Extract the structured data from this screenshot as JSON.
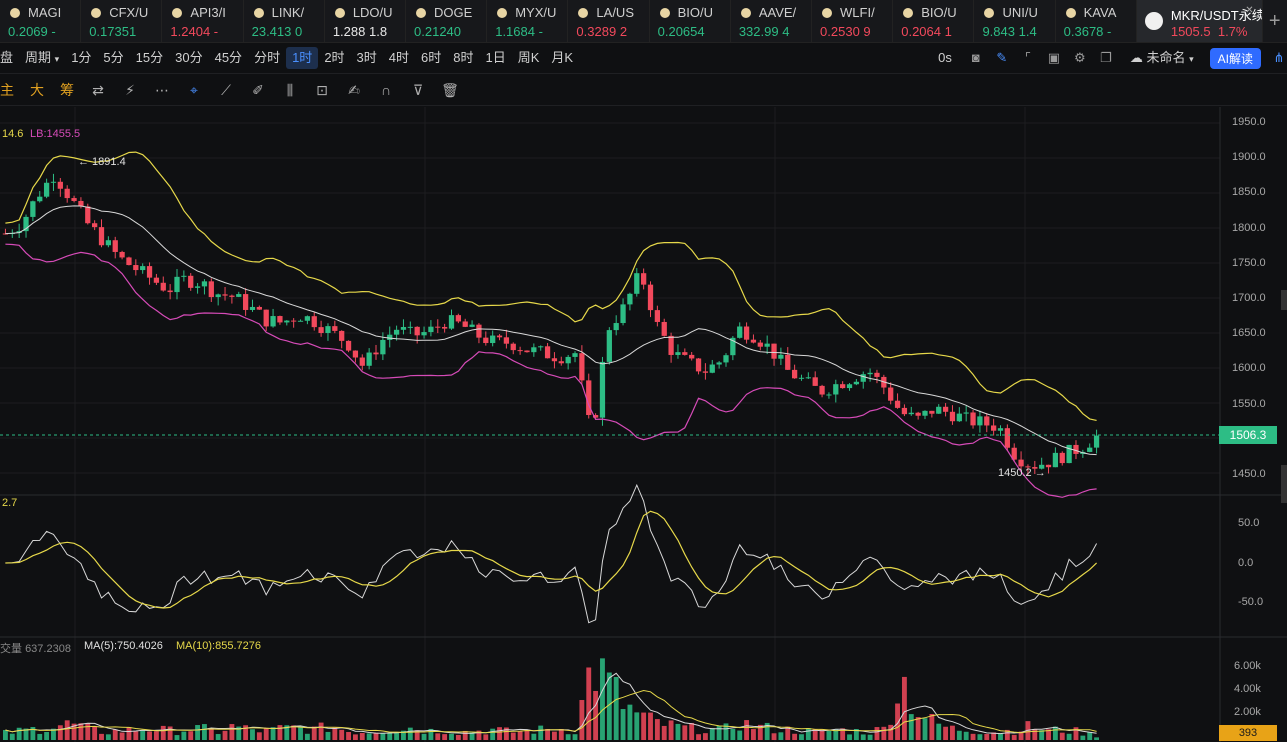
{
  "tabs": [
    {
      "symbol": "MAGI",
      "price": "0.2069",
      "change": "-",
      "dir": "g"
    },
    {
      "symbol": "CFX/U",
      "price": "0.17351",
      "change": "",
      "dir": "g"
    },
    {
      "symbol": "API3/I",
      "price": "1.2404",
      "change": "-",
      "dir": "r"
    },
    {
      "symbol": "LINK/",
      "price": "23.413",
      "change": "0",
      "dir": "g"
    },
    {
      "symbol": "LDO/U",
      "price": "1.288",
      "change": "1.8",
      "dir": "w"
    },
    {
      "symbol": "DOGE",
      "price": "0.21240",
      "change": "",
      "dir": "g"
    },
    {
      "symbol": "MYX/U",
      "price": "1.1684",
      "change": "-",
      "dir": "g"
    },
    {
      "symbol": "LA/US",
      "price": "0.3289",
      "change": "2",
      "dir": "r"
    },
    {
      "symbol": "BIO/U",
      "price": "0.20654",
      "change": "",
      "dir": "g"
    },
    {
      "symbol": "AAVE/",
      "price": "332.99",
      "change": "4",
      "dir": "g"
    },
    {
      "symbol": "WLFI/",
      "price": "0.2530",
      "change": "9",
      "dir": "r"
    },
    {
      "symbol": "BIO/U",
      "price": "0.2064",
      "change": "1",
      "dir": "r"
    },
    {
      "symbol": "UNI/U",
      "price": "9.843",
      "change": "1.4",
      "dir": "g"
    },
    {
      "symbol": "KAVA",
      "price": "0.3678",
      "change": "-",
      "dir": "g"
    }
  ],
  "active_tab": {
    "symbol": "MKR/USDT永续",
    "price": "1505.5",
    "change": "1.7%"
  },
  "toolbar": {
    "left_label": "盘",
    "period_label": "周期",
    "intervals": [
      "1分",
      "5分",
      "15分",
      "30分",
      "45分",
      "分时",
      "1时",
      "2时",
      "3时",
      "4时",
      "6时",
      "8时",
      "1日",
      "周K",
      "月K"
    ],
    "selected_interval": "1时",
    "timer": "0s",
    "layout_name": "未命名",
    "ai_label": "AI解读"
  },
  "toolbar2": {
    "labels": [
      "主",
      "大",
      "筹"
    ]
  },
  "chart_labels": {
    "bb_legend_left": "14.6",
    "bb_legend_lb": "LB:1455.5",
    "high_marker": "← 1891.4",
    "low_marker": "1450.2 →",
    "osc_legend": "2.7",
    "vol_legend_name": "交量",
    "vol_legend_value": "637.2308",
    "ma5": "MA(5):750.4026",
    "ma10": "MA(10):855.7276"
  },
  "price_axis": [
    "1950.0",
    "1900.0",
    "1850.0",
    "1800.0",
    "1750.0",
    "1700.0",
    "1650.0",
    "1600.0",
    "1550.0",
    "1500.0",
    "1450.0"
  ],
  "current_price": "1506.3",
  "osc_axis": [
    "50.0",
    "0.0",
    "-50.0"
  ],
  "vol_axis": [
    "6.00k",
    "4.00k",
    "2.00k"
  ],
  "current_volume": "393",
  "colors": {
    "up": "#2dbd85",
    "down": "#f2495c",
    "upper_band": "#e6d84a",
    "lower_band": "#d64bb8",
    "mid_band": "#d8d8d8",
    "accent": "#2f6bff"
  },
  "chart_data": {
    "type": "candlestick",
    "ylim": [
      1430,
      1975
    ],
    "close_path": [
      1795,
      1810,
      1850,
      1880,
      1845,
      1810,
      1785,
      1760,
      1745,
      1730,
      1715,
      1730,
      1725,
      1710,
      1705,
      1690,
      1672,
      1668,
      1680,
      1670,
      1655,
      1640,
      1605,
      1640,
      1660,
      1650,
      1655,
      1670,
      1665,
      1650,
      1640,
      1640,
      1630,
      1625,
      1620,
      1625,
      1505,
      1660,
      1690,
      1740,
      1665,
      1625,
      1610,
      1600,
      1615,
      1660,
      1650,
      1630,
      1600,
      1585,
      1570,
      1580,
      1590,
      1600,
      1575,
      1540,
      1530,
      1545,
      1540,
      1530,
      1525,
      1520,
      1480,
      1465,
      1470,
      1480,
      1490,
      1506
    ],
    "volume_path": [
      0.6,
      0.8,
      1.0,
      1.2,
      1.4,
      1.0,
      0.7,
      0.8,
      0.9,
      1.0,
      0.8,
      0.9,
      1.0,
      0.7,
      1.2,
      0.9,
      0.8,
      1.0,
      1.1,
      0.9,
      1.2,
      0.8,
      0.7,
      0.9,
      1.0,
      1.1,
      0.8,
      0.9,
      0.7,
      0.8,
      0.9,
      0.7,
      0.8,
      0.9,
      1.0,
      0.8,
      6.5,
      5.0,
      3.0,
      2.0,
      1.5,
      1.2,
      1.0,
      1.0,
      0.8,
      1.5,
      1.2,
      1.0,
      0.9,
      0.8,
      0.7,
      0.9,
      0.8,
      0.7,
      1.0,
      5.5,
      2.5,
      1.5,
      1.0,
      0.9,
      0.8,
      0.7,
      0.9,
      1.2,
      0.8,
      0.9,
      0.7,
      0.4
    ]
  }
}
